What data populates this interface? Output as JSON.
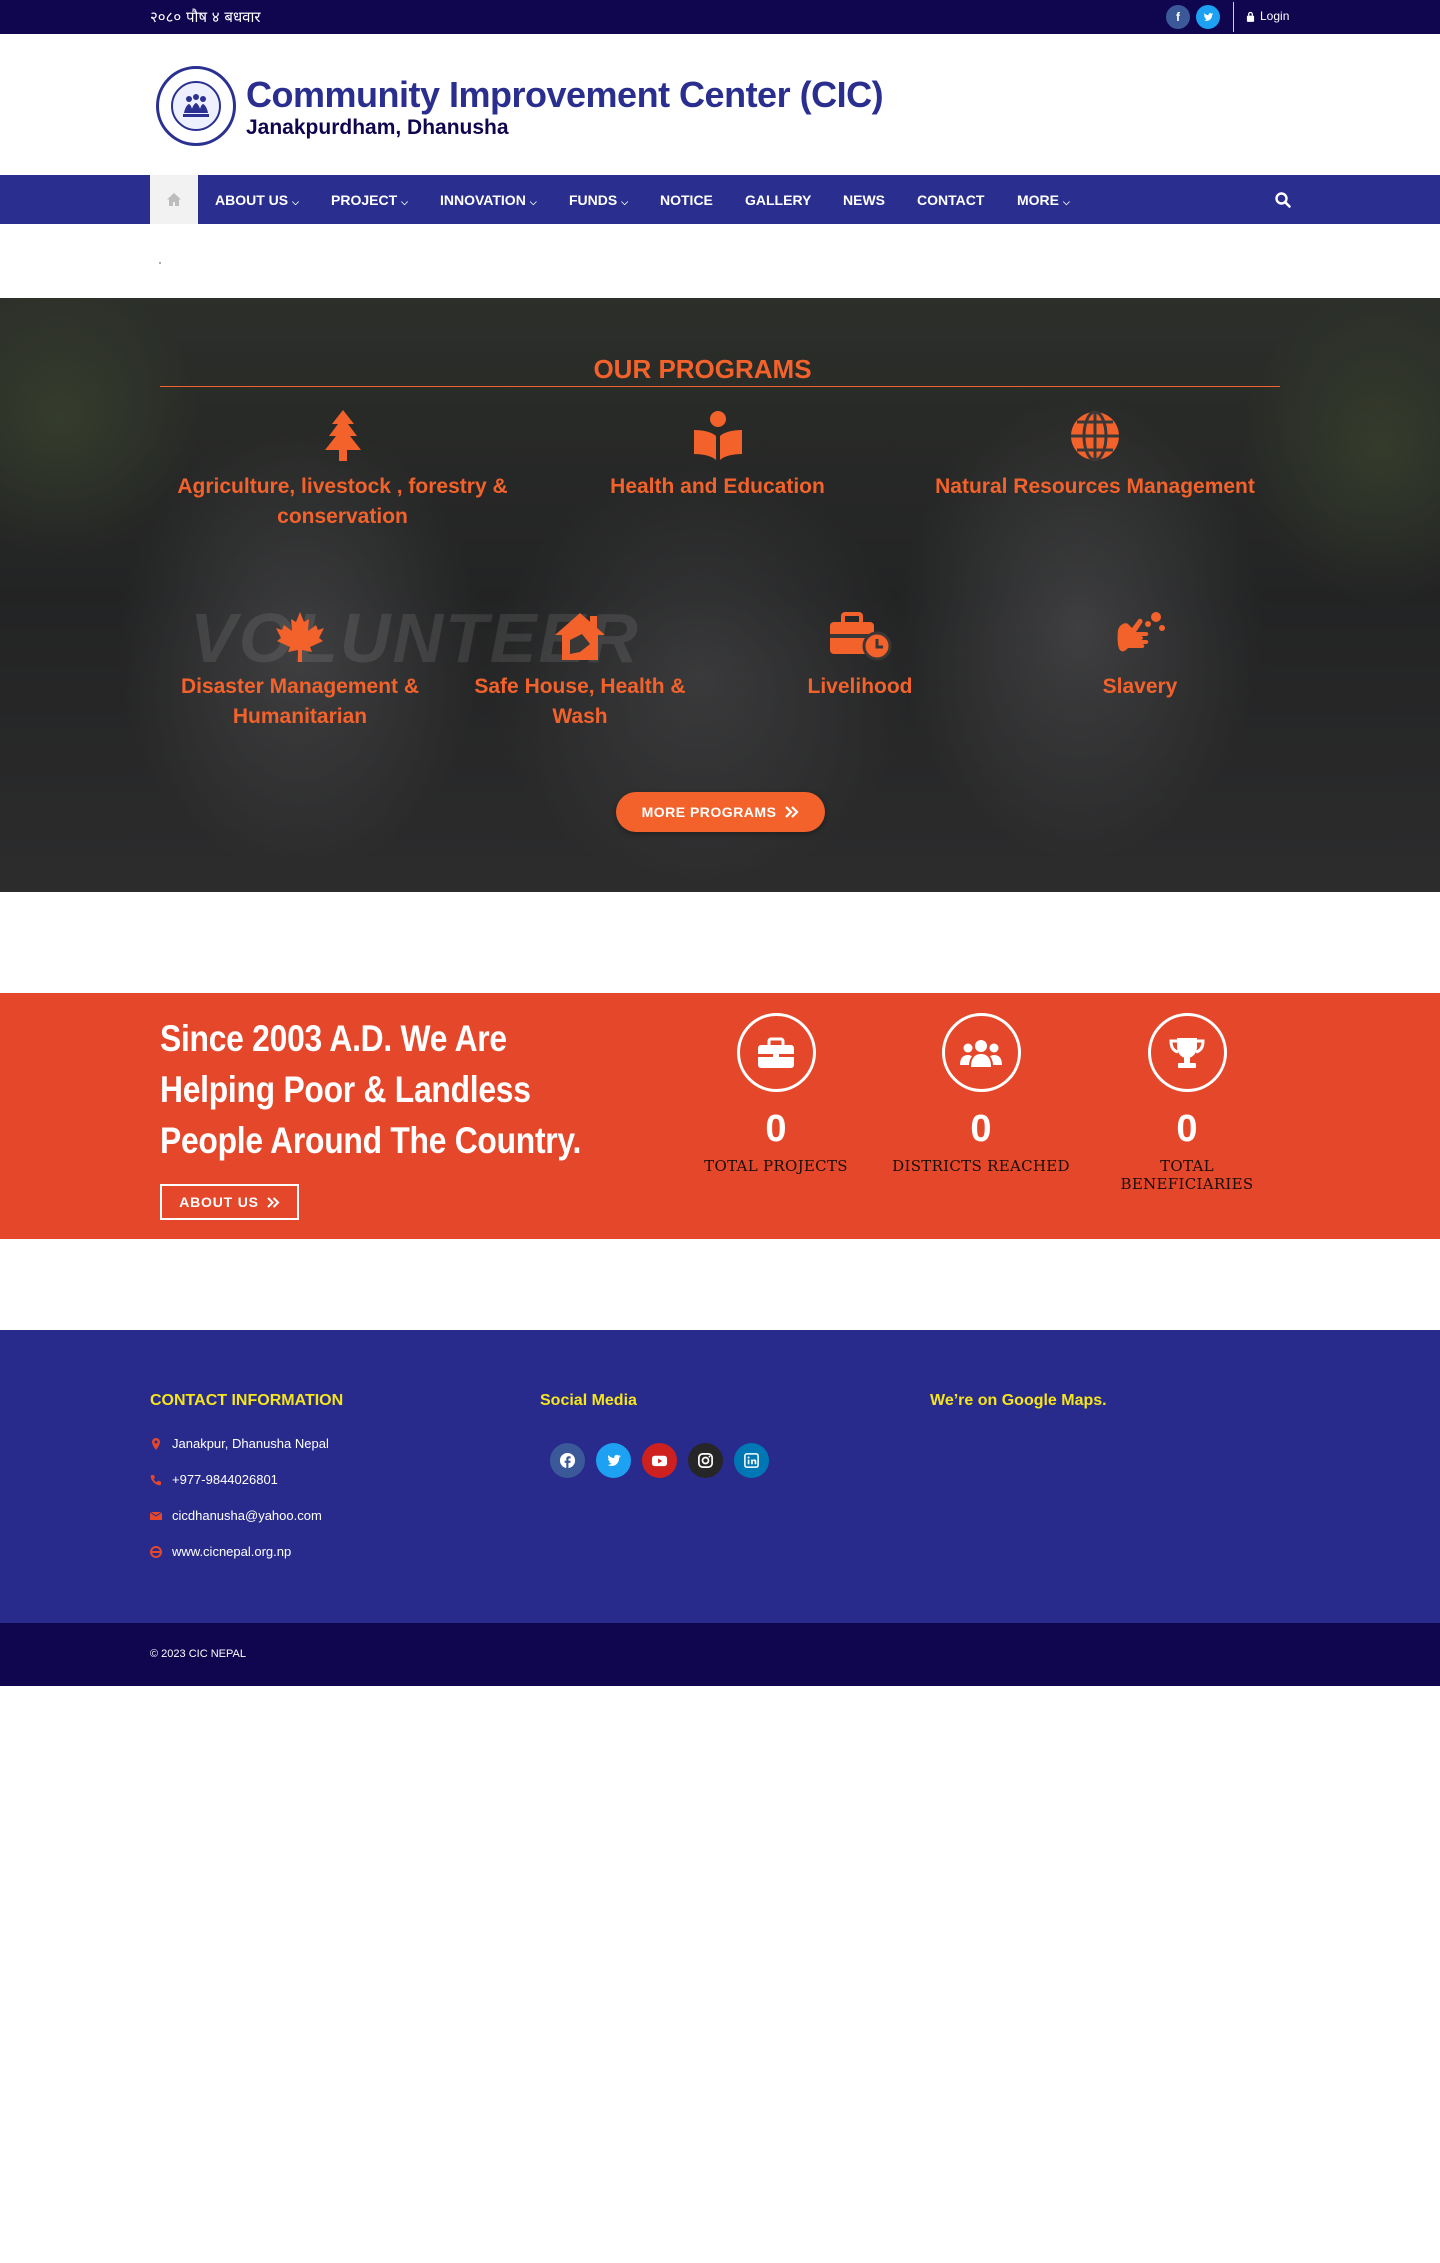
{
  "topbar": {
    "date": "२०८० पौष ४ बधवार",
    "login_label": "Login",
    "facebook_glyph": "f",
    "twitter_glyph": "t"
  },
  "header": {
    "org_name": "Community Improvement Center (CIC)",
    "location": "Janakpurdham, Dhanusha",
    "logo_icon": "people-emblem-icon"
  },
  "nav": {
    "items": [
      {
        "label": "ABOUT US",
        "dropdown": true
      },
      {
        "label": "PROJECT",
        "dropdown": true
      },
      {
        "label": "INNOVATION",
        "dropdown": true
      },
      {
        "label": "FUNDS",
        "dropdown": true
      },
      {
        "label": "NOTICE",
        "dropdown": false
      },
      {
        "label": "GALLERY",
        "dropdown": false
      },
      {
        "label": "NEWS",
        "dropdown": false
      },
      {
        "label": "CONTACT",
        "dropdown": false
      },
      {
        "label": "MORE",
        "dropdown": true
      }
    ],
    "caret": "⌵"
  },
  "programs": {
    "title": "OUR PROGRAMS",
    "items": [
      {
        "label": "Agriculture, livestock , forestry & conservation",
        "icon": "tree-icon"
      },
      {
        "label": "Health and Education",
        "icon": "reader-icon"
      },
      {
        "label": "Natural Resources Management",
        "icon": "globe-icon"
      },
      {
        "label": "Disaster Management & Humanitarian",
        "icon": "maple-leaf-icon"
      },
      {
        "label": "Safe House, Health & Wash",
        "icon": "house-icon"
      },
      {
        "label": "Livelihood",
        "icon": "business-time-icon"
      },
      {
        "label": "Slavery",
        "icon": "hands-wash-icon"
      }
    ],
    "more_button": "MORE PROGRAMS",
    "accent": "#f4622b"
  },
  "stats": {
    "headline": "Since 2003 A.D. We Are Helping Poor & Landless People Around The Country.",
    "about_button": "ABOUT US",
    "items": [
      {
        "value": "0",
        "label": "TOTAL PROJECTS",
        "icon": "briefcase-icon"
      },
      {
        "value": "0",
        "label": "DISTRICTS REACHED",
        "icon": "users-icon"
      },
      {
        "value": "0",
        "label": "TOTAL BENEFICIARIES",
        "icon": "trophy-icon"
      }
    ],
    "band_color": "#e5472b"
  },
  "footer": {
    "contact_title": "CONTACT INFORMATION",
    "address": "Janakpur, Dhanusha Nepal",
    "phone": "+977-9844026801",
    "email": "cicdhanusha@yahoo.com",
    "website": "www.cicnepal.org.np",
    "social_title": "Social Media",
    "maps_title": "We’re on Google Maps.",
    "social_icons": [
      "facebook-icon",
      "twitter-icon",
      "youtube-icon",
      "instagram-icon",
      "linkedin-icon"
    ],
    "copyright": "© 2023 CIC NEPAL"
  }
}
